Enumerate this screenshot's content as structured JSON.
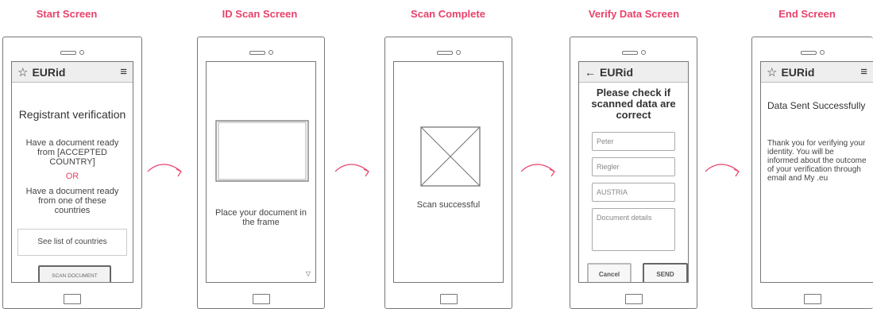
{
  "titles": [
    "Start Screen",
    "ID Scan Screen",
    "Scan Complete",
    "Verify Data Screen",
    "End Screen"
  ],
  "brand": "EURid",
  "colors": {
    "accent": "#e8426a",
    "stroke": "#777777"
  },
  "start": {
    "heading": "Registrant verification",
    "text1": "Have a document ready from [ACCEPTED COUNTRY]",
    "or": "OR",
    "text2": "Have a document ready from one of these countries",
    "list_button": "See list of countries",
    "scan_button": "SCAN DOCUMENT"
  },
  "idscan": {
    "instruction": "Place your document in the frame"
  },
  "complete": {
    "message": "Scan successful"
  },
  "verify": {
    "heading": "Please check if scanned data are correct",
    "fields": [
      "Peter",
      "Riegler",
      "AUSTRIA"
    ],
    "details_placeholder": "Document details",
    "cancel": "Cancel",
    "send": "SEND"
  },
  "end": {
    "heading": "Data Sent Successfully",
    "body": "Thank you for verifying your identity. You will be informed about the outcome of your verification through email and My .eu"
  }
}
